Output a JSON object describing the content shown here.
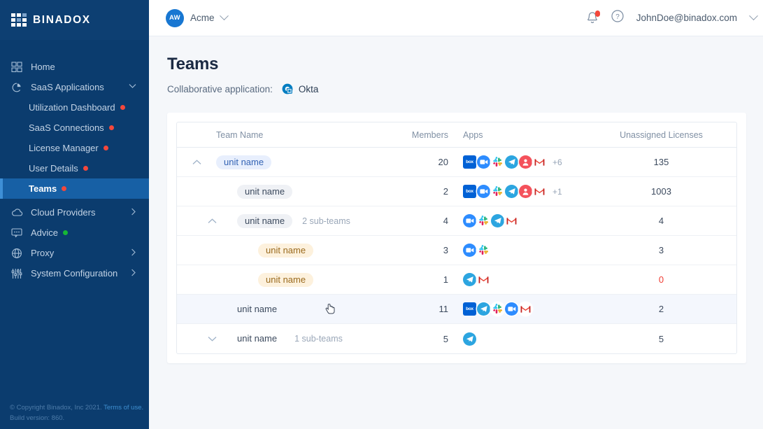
{
  "sidebar": {
    "logo_text": "BINADOX",
    "items": [
      {
        "label": "Home",
        "icon": "grid-icon",
        "level": 0,
        "dot": null,
        "chevron": null,
        "active": false
      },
      {
        "label": "SaaS Applications",
        "icon": "pie-chart-icon",
        "level": 0,
        "dot": null,
        "chevron": "down",
        "active": false
      },
      {
        "label": "Utilization Dashboard",
        "icon": null,
        "level": 1,
        "dot": "red",
        "chevron": null,
        "active": false
      },
      {
        "label": "SaaS Connections",
        "icon": null,
        "level": 1,
        "dot": "red",
        "chevron": null,
        "active": false
      },
      {
        "label": "License Manager",
        "icon": null,
        "level": 1,
        "dot": "red",
        "chevron": null,
        "active": false
      },
      {
        "label": "User Details",
        "icon": null,
        "level": 1,
        "dot": "red",
        "chevron": null,
        "active": false
      },
      {
        "label": "Teams",
        "icon": null,
        "level": 1,
        "dot": "red",
        "chevron": null,
        "active": true
      },
      {
        "label": "Cloud Providers",
        "icon": "cloud-icon",
        "level": 0,
        "dot": null,
        "chevron": "right",
        "active": false
      },
      {
        "label": "Advice",
        "icon": "chat-bubble-icon",
        "level": 0,
        "dot": "green",
        "chevron": null,
        "active": false
      },
      {
        "label": "Proxy",
        "icon": "globe-icon",
        "level": 0,
        "dot": null,
        "chevron": "right",
        "active": false
      },
      {
        "label": "System Configuration",
        "icon": "sliders-icon",
        "level": 0,
        "dot": null,
        "chevron": "right",
        "active": false
      }
    ],
    "footer": {
      "copyright": "© Copyright Binadox, Inc 2021.",
      "terms_link": "Terms of use.",
      "build": "Build version: 860."
    }
  },
  "topbar": {
    "avatar_initials": "AW",
    "org_name": "Acme",
    "notifications_icon": "bell-icon",
    "help_icon": "question-mark-icon",
    "user_email": "JohnDoe@binadox.com"
  },
  "page": {
    "title": "Teams",
    "collaborative_label": "Collaborative application:",
    "collaborative_app": "Okta",
    "collaborative_app_icon": "okta-icon"
  },
  "table": {
    "columns": {
      "team_name": "Team Name",
      "members": "Members",
      "apps": "Apps",
      "unassigned_licenses": "Unassigned Licenses"
    },
    "rows": [
      {
        "name": "unit name",
        "chip_style": "blue",
        "indent": 0,
        "toggle": "collapse",
        "toggle_indent": 0,
        "sub_teams": "",
        "members": "20",
        "apps": [
          "box",
          "zoom",
          "slack",
          "telegram",
          "person",
          "gmail"
        ],
        "apps_overflow": "+6",
        "unassigned": "135",
        "unassigned_zero": false,
        "hover": false
      },
      {
        "name": "unit name",
        "chip_style": "grey",
        "indent": 1,
        "toggle": null,
        "toggle_indent": 0,
        "sub_teams": "",
        "members": "2",
        "apps": [
          "box",
          "zoom",
          "slack",
          "telegram",
          "person",
          "gmail"
        ],
        "apps_overflow": "+1",
        "unassigned": "1003",
        "unassigned_zero": false,
        "hover": false
      },
      {
        "name": "unit name",
        "chip_style": "grey",
        "indent": 1,
        "toggle": "collapse",
        "toggle_indent": 1,
        "sub_teams": "2 sub-teams",
        "members": "4",
        "apps": [
          "zoom",
          "slack",
          "telegram",
          "gmail"
        ],
        "apps_overflow": "",
        "unassigned": "4",
        "unassigned_zero": false,
        "hover": false
      },
      {
        "name": "unit name",
        "chip_style": "orange",
        "indent": 2,
        "toggle": null,
        "toggle_indent": 0,
        "sub_teams": "",
        "members": "3",
        "apps": [
          "zoom",
          "slack"
        ],
        "apps_overflow": "",
        "unassigned": "3",
        "unassigned_zero": false,
        "hover": false
      },
      {
        "name": "unit name",
        "chip_style": "orange",
        "indent": 2,
        "toggle": null,
        "toggle_indent": 0,
        "sub_teams": "",
        "members": "1",
        "apps": [
          "telegram",
          "gmail"
        ],
        "apps_overflow": "",
        "unassigned": "0",
        "unassigned_zero": true,
        "hover": false
      },
      {
        "name": "unit name",
        "chip_style": "plain",
        "indent": 1,
        "toggle": null,
        "toggle_indent": 0,
        "sub_teams": "",
        "members": "11",
        "apps": [
          "box",
          "telegram",
          "slack",
          "zoom",
          "gmail"
        ],
        "apps_overflow": "",
        "unassigned": "2",
        "unassigned_zero": false,
        "hover": true
      },
      {
        "name": "unit name",
        "chip_style": "plain",
        "indent": 1,
        "toggle": "expand",
        "toggle_indent": 1,
        "sub_teams": "1 sub-teams",
        "members": "5",
        "apps": [
          "telegram"
        ],
        "apps_overflow": "",
        "unassigned": "5",
        "unassigned_zero": false,
        "hover": false
      }
    ]
  },
  "colors": {
    "sidebar_bg": "#0b3c6e",
    "sidebar_active": "#1760a5",
    "accent_blue": "#1877d2",
    "alert_red": "#f4483c",
    "ok_green": "#16b836",
    "page_bg": "#f5f7fa"
  }
}
